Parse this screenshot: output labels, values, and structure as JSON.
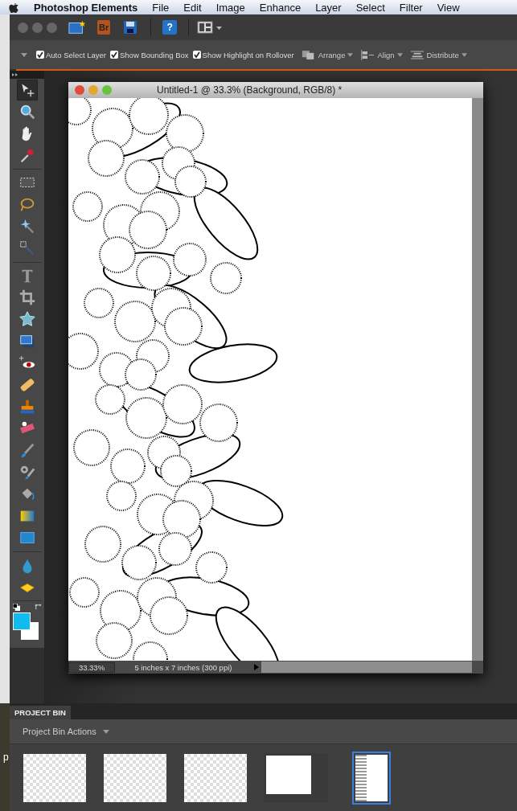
{
  "menu_bar": {
    "app_name": "Photoshop Elements",
    "items": [
      "File",
      "Edit",
      "Image",
      "Enhance",
      "Layer",
      "Select",
      "Filter",
      "View"
    ]
  },
  "toolbar": [
    {
      "kind": "new"
    },
    {
      "kind": "bridge",
      "label": "Br"
    },
    {
      "kind": "save"
    },
    {
      "kind": "help",
      "label": "?"
    },
    {
      "kind": "layout"
    }
  ],
  "options_bar": {
    "checkboxes": [
      {
        "label": "Auto Select Layer",
        "checked": true
      },
      {
        "label": "Show Bounding Box",
        "checked": true
      },
      {
        "label": "Show Highlight on Rollover",
        "checked": true
      }
    ],
    "dropdowns": [
      {
        "kind": "arrange",
        "label": "Arrange"
      },
      {
        "kind": "align",
        "label": "Align"
      },
      {
        "kind": "distribute",
        "label": "Distribute"
      }
    ]
  },
  "tool_groups": [
    [
      {
        "kind": "move",
        "selected": true
      },
      {
        "kind": "zoom",
        "selected": false
      },
      {
        "kind": "hand",
        "selected": false
      },
      {
        "kind": "eyedropper",
        "selected": false
      }
    ],
    [
      {
        "kind": "marquee",
        "selected": false
      },
      {
        "kind": "lasso",
        "selected": false
      },
      {
        "kind": "wand",
        "selected": false
      },
      {
        "kind": "brushselect",
        "selected": false
      }
    ],
    [
      {
        "kind": "type",
        "selected": false
      },
      {
        "kind": "crop",
        "selected": false
      },
      {
        "kind": "cookie",
        "selected": false
      },
      {
        "kind": "recompose",
        "selected": false
      },
      {
        "kind": "redeye",
        "selected": false
      },
      {
        "kind": "heal",
        "selected": false
      },
      {
        "kind": "stamp",
        "selected": false
      },
      {
        "kind": "eraser",
        "selected": false
      },
      {
        "kind": "brush",
        "selected": false
      },
      {
        "kind": "smartbrush",
        "selected": false
      },
      {
        "kind": "bucket",
        "selected": false
      },
      {
        "kind": "gradient",
        "selected": false
      },
      {
        "kind": "shape",
        "selected": false
      }
    ],
    [
      {
        "kind": "blur",
        "selected": false
      },
      {
        "kind": "sponge",
        "selected": false
      }
    ]
  ],
  "color_swatches": [
    {
      "kind": "foreground",
      "color": "#10bcee"
    },
    {
      "kind": "background",
      "color": "#ffffff"
    }
  ],
  "document": {
    "title": "Untitled-1 @ 33.3% (Background, RGB/8) *",
    "zoom": "33.33%",
    "info": "5 inches x 7 inches (300 ppi)"
  },
  "project_bin": {
    "tab": "PROJECT BIN",
    "actions": "Project Bin Actions",
    "thumbnails": [
      {
        "kind": "transparent",
        "selected": false
      },
      {
        "kind": "transparent",
        "selected": false
      },
      {
        "kind": "transparent",
        "selected": false
      },
      {
        "kind": "screenshot",
        "selected": false
      },
      {
        "kind": "document",
        "selected": true
      }
    ]
  },
  "desktop_label": "p"
}
